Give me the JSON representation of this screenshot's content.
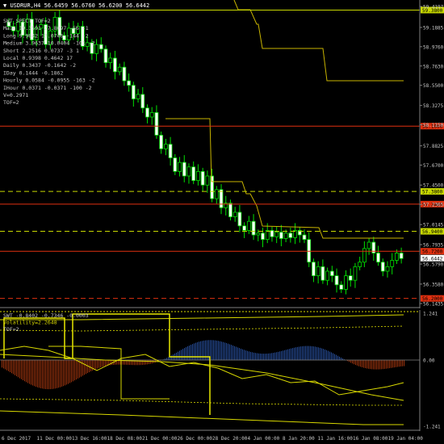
{
  "symbol_header": "USDRUR,H4  56.6459 56.6760 56.6200 56.6442",
  "main_legend": [
    "SWT_SPECT  TOF=2",
    "Main      19.3591  27.8097   -56   -1",
    "Long       9.9842  13.0746  -144   -2",
    "Medium     3.9637  10.0404  -101   -2",
    "Short      2.2516   0.0737    -3    1",
    "Local      0.9398   0.4642    17",
    "Daily      0.3437  -0.1642    -2",
    "IDay       0.1444  -0.1862",
    "Hourly     0.0584  -0.0955  -163   -2",
    "IHour      0.0371  -0.0371  -100   -2",
    "V=0.2971",
    "TOF=2"
  ],
  "sub_legend": [
    "SWT -0.8402 -0.7346 -0.0003",
    "Volatility=2.2648",
    "TOF=2"
  ],
  "price_axis": {
    "min": 56.1435,
    "max": 59.4197,
    "ticks": [
      "59.4197",
      "59.1885",
      "58.9760",
      "58.7630",
      "58.5500",
      "58.3275",
      "58.1150",
      "57.8825",
      "57.6700",
      "57.4500",
      "57.2365",
      "57.0145",
      "56.7935",
      "56.5790",
      "56.3580",
      "56.1435"
    ]
  },
  "price_levels": [
    {
      "label": "59.3800",
      "value": 59.38,
      "style": "solid",
      "color": "#c8d800"
    },
    {
      "label": "58.1000",
      "value": 58.1,
      "style": "solid",
      "color": "#e03010"
    },
    {
      "label": "57.3800",
      "value": 57.38,
      "style": "dashed",
      "color": "#c8d800"
    },
    {
      "label": "57.2400",
      "value": 57.24,
      "style": "solid",
      "color": "#e03010"
    },
    {
      "label": "56.9400",
      "value": 56.94,
      "style": "dashed",
      "color": "#c8d800"
    },
    {
      "label": "56.7200",
      "value": 56.72,
      "style": "solid",
      "color": "#e03010"
    },
    {
      "label": "56.2000",
      "value": 56.2,
      "style": "dashed",
      "color": "#e03010"
    }
  ],
  "current_price": {
    "label": "56.6442",
    "value": 56.6442
  },
  "sub_axis": {
    "min": -1.241,
    "max": 1.241,
    "ticks": [
      "1.241",
      "0.00",
      "-1.241"
    ]
  },
  "time_labels": [
    "6 Dec 2017",
    "11 Dec 00:00",
    "13 Dec 16:00",
    "18 Dec 08:00",
    "21 Dec 00:00",
    "26 Dec 00:00",
    "28 Dec 20:00",
    "4 Jan 00:00",
    "8 Jan 20:00",
    "11 Jan 16:00",
    "16 Jan 08:00",
    "19 Jan 04:00"
  ],
  "chart_data": {
    "type": "candlestick",
    "title": "USDRUR,H4",
    "closes": [
      59.2,
      59.15,
      59.25,
      59.1,
      59.28,
      59.05,
      59.18,
      59.22,
      59.0,
      59.15,
      59.3,
      59.1,
      59.05,
      59.18,
      59.12,
      59.2,
      58.98,
      59.02,
      58.9,
      59.0,
      58.95,
      58.8,
      58.85,
      58.7,
      58.75,
      58.6,
      58.55,
      58.4,
      58.45,
      58.3,
      58.2,
      58.25,
      58.0,
      57.85,
      57.9,
      57.75,
      57.6,
      57.7,
      57.55,
      57.65,
      57.5,
      57.6,
      57.45,
      57.55,
      57.3,
      57.4,
      57.2,
      57.25,
      57.1,
      57.15,
      57.0,
      56.95,
      57.05,
      56.9,
      56.92,
      56.85,
      56.95,
      56.88,
      56.93,
      56.86,
      56.92,
      56.87,
      56.95,
      56.9,
      56.85,
      56.6,
      56.45,
      56.55,
      56.4,
      56.5,
      56.45,
      56.35,
      56.3,
      56.45,
      56.4,
      56.55,
      56.6,
      56.75,
      56.82,
      56.7,
      56.6,
      56.5,
      56.55,
      56.62,
      56.7,
      56.64
    ]
  }
}
